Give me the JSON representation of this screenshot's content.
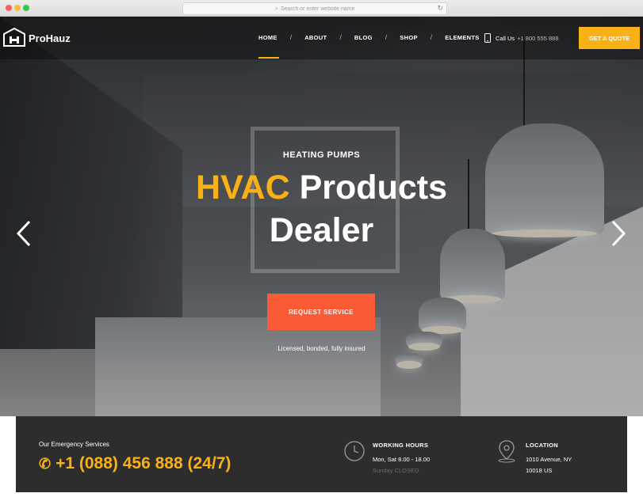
{
  "browser": {
    "url_placeholder": "Search or enter website name"
  },
  "header": {
    "logo_text": "ProHauz",
    "nav": [
      "HOME",
      "ABOUT",
      "BLOG",
      "SHOP",
      "ELEMENTS"
    ],
    "active_nav": "HOME",
    "call_label": "Call Us",
    "call_number": "+1 800 555 888",
    "quote_button": "GET A QUOTE",
    "accent_color": "#f9b115"
  },
  "hero": {
    "eyebrow": "HEATING PUMPS",
    "headline_accent": "HVAC",
    "headline_rest": " Products",
    "headline_line2": "Dealer",
    "cta_button": "REQUEST SERVICE",
    "cta_color": "#fa5a35",
    "tagline": "Licensed, bonded, fully insured",
    "prev_icon": "chevron-left-icon",
    "next_icon": "chevron-right-icon"
  },
  "infobar": {
    "emergency_label": "Our Emergency Services",
    "emergency_phone": "+1 (088) 456 888 (24/7)",
    "hours_title": "WORKING HOURS",
    "hours_line1": "Mon, Sat 8.00 - 18.00",
    "hours_line2": "Sunday CLOSED",
    "location_title": "LOCATION",
    "location_line1": "1010 Avenue, NY",
    "location_line2": "10018 US"
  }
}
